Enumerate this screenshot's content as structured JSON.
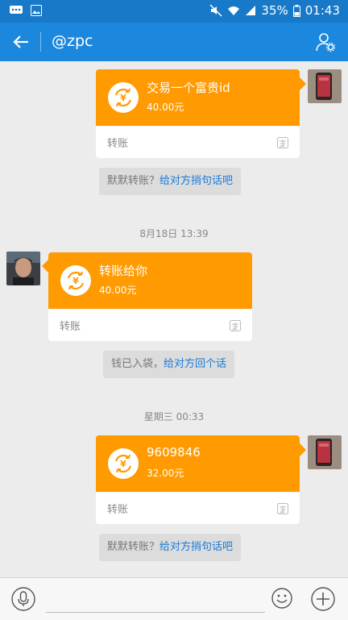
{
  "status_bar": {
    "battery": "35%",
    "time": "01:43"
  },
  "header": {
    "title": "@zpc"
  },
  "messages": {
    "m1": {
      "title": "交易一个富贵id",
      "amount": "40.00元",
      "footer": "转账"
    },
    "s1": {
      "text": "默默转账？",
      "link": "给对方捎句话吧"
    },
    "t1": "8月18日 13:39",
    "m2": {
      "title": "转账给你",
      "amount": "40.00元",
      "footer": "转账"
    },
    "s2": {
      "text": "钱已入袋，",
      "link": "给对方回个话"
    },
    "t2": "星期三 00:33",
    "m3": {
      "title": "9609846",
      "amount": "32.00元",
      "footer": "转账"
    },
    "s3": {
      "text": "默默转账？",
      "link": "给对方捎句话吧"
    }
  },
  "colors": {
    "header": "#1b87dd",
    "status": "#1879c9",
    "card": "#ff9a00",
    "link": "#1b7ad6"
  },
  "icons": [
    "back-arrow-icon",
    "profile-settings-icon",
    "transfer-yen-icon",
    "alipay-icon",
    "mic-icon",
    "emoji-icon",
    "plus-icon"
  ]
}
